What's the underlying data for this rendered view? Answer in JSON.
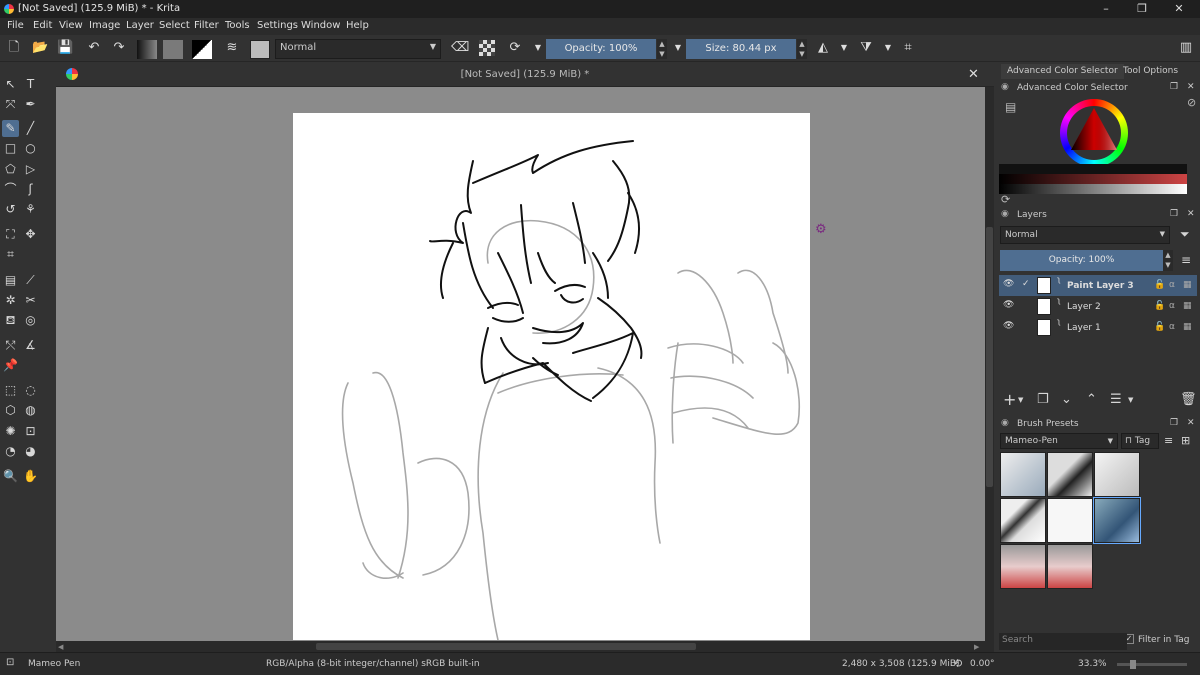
{
  "window": {
    "title": "[Not Saved]  (125.9 MiB) * - Krita",
    "min": "–",
    "max": "❐",
    "close": "✕"
  },
  "menu": [
    "File",
    "Edit",
    "View",
    "Image",
    "Layer",
    "Select",
    "Filter",
    "Tools",
    "Settings",
    "Window",
    "Help"
  ],
  "toolbar": {
    "blend_mode": "Normal",
    "opacity_label": "Opacity: 100%",
    "size_label": "Size: 80.44 px"
  },
  "document": {
    "tab_title": "[Not Saved]  (125.9 MiB) *",
    "close": "✕"
  },
  "dock": {
    "tabs": [
      "Advanced Color Selector",
      "Tool Options"
    ],
    "color_panel_title": "Advanced Color Selector",
    "layers_title": "Layers",
    "layer_blend": "Normal",
    "layer_opacity": "Opacity:  100%",
    "layers": [
      {
        "name": "Paint Layer 3",
        "selected": true
      },
      {
        "name": "Layer 2",
        "selected": false
      },
      {
        "name": "Layer 1",
        "selected": false
      }
    ],
    "brush_presets_title": "Brush Presets",
    "brush_preset_selected": "Mameo-Pen",
    "tag_label": "Tag",
    "search_placeholder": "Search",
    "filter_in_tag": "Filter in Tag"
  },
  "status": {
    "brush": "Mameo Pen",
    "color_space": "RGB/Alpha (8-bit integer/channel)  sRGB built-in",
    "doc_size": "2,480 x 3,508 (125.9 MiB)",
    "rotation": "0.00°",
    "zoom": "33.3%"
  },
  "colors": {
    "accent": "#4f6e91",
    "selection": "#425c7a",
    "canvas_bg": "#8b8b8b"
  }
}
